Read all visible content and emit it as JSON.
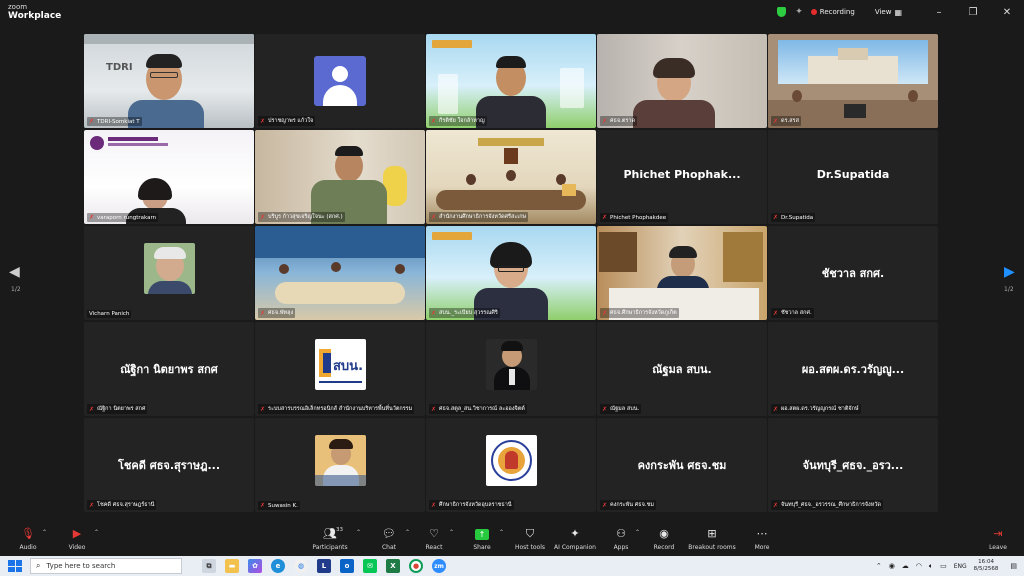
{
  "titlebar": {
    "logo_line1": "zoom",
    "logo_line2": "Workplace",
    "recording_label": "Recording",
    "view_label": "View",
    "minimize": "–",
    "restore": "❐",
    "close": "✕"
  },
  "tiles": [
    {
      "name": "TDRI-Somkiat T",
      "kind": "video",
      "active": true
    },
    {
      "name": "ปราชญาพร แก้วใจ",
      "kind": "placeholder"
    },
    {
      "name": "กีรติชัย ใจกล้าหาญ",
      "kind": "video"
    },
    {
      "name": "ศธจ.ตราด",
      "kind": "video"
    },
    {
      "name": "ดร.สรส",
      "kind": "video"
    },
    {
      "name": "varaporn rungtrakarn",
      "kind": "video"
    },
    {
      "name": "บริบูร ก้าวสุขเจริญใจนะ (สกศ.)",
      "kind": "video"
    },
    {
      "name": "สำนักงานศึกษาธิการจังหวัดศรีสะเกษ",
      "kind": "video"
    },
    {
      "name": "Phichet Phophakdee",
      "kind": "text",
      "display": "Phichet  Phophak..."
    },
    {
      "name": "Dr.Supatida",
      "kind": "text",
      "display": "Dr.Supatida"
    },
    {
      "name": "Vicharn Panich",
      "kind": "photo"
    },
    {
      "name": "ศธจ.พัทลุง",
      "kind": "video"
    },
    {
      "name": "สบน._ระเบียบ สุวรรณศิริ",
      "kind": "video"
    },
    {
      "name": "ศธจ.ศึกษาธิการจังหวัดภูเก็ต",
      "kind": "video"
    },
    {
      "name": "ชัชวาล สกศ.",
      "kind": "text",
      "display": "ชัชวาล สกศ."
    },
    {
      "name": "ณัฐิกา นิตยาพร สกศ",
      "kind": "text",
      "display": "ณัฐิกา นิตยาพร สกศ"
    },
    {
      "name": "ระบบสารบรรณอิเล็กทรอนิกส์ สำนักงานบริหารพื้นที่นวัตกรรม",
      "kind": "logo-sbn",
      "logo_text": "สบน."
    },
    {
      "name": "ศธจ.สตูล_สน.วิชาการณ์ ละอองจิตต์",
      "kind": "photo2"
    },
    {
      "name": "ณัฐมล สบน.",
      "kind": "text",
      "display": "ณัฐมล สบน."
    },
    {
      "name": "ผอ.สตผ.ดร.วรัญญูกรณ์ ชาติจักษ์",
      "kind": "text",
      "display": "ผอ.สตผ.ดร.วรัญญู..."
    },
    {
      "name": "โชคดี ศธจ.สุราษฎร์ธานี",
      "kind": "text",
      "display": "โชคดี ศธจ.สุราษฎ..."
    },
    {
      "name": "Suwasin K.",
      "kind": "photo3"
    },
    {
      "name": "ศึกษาธิการจังหวัดอุบลราชธานี",
      "kind": "logo-seal"
    },
    {
      "name": "คงกระพัน ศธจ.ชม",
      "kind": "text",
      "display": "คงกระพัน ศธจ.ชม"
    },
    {
      "name": "จันทบุรี_ศธจ._อรวรรณ_ศึกษาธิการจังหวัด",
      "kind": "text",
      "display": "จันทบุรี_ศธจ._อรว..."
    }
  ],
  "pager": {
    "left": "1/2",
    "right": "1/2"
  },
  "toolbar": {
    "audio": "Audio",
    "video": "Video",
    "participants": "Participants",
    "participants_count": "33",
    "chat": "Chat",
    "react": "React",
    "share": "Share",
    "host_tools": "Host tools",
    "ai_companion": "AI Companion",
    "apps": "Apps",
    "record": "Record",
    "breakout": "Breakout rooms",
    "more": "More",
    "leave": "Leave"
  },
  "taskbar": {
    "search_placeholder": "Type here to search",
    "lang": "ENG",
    "time": "16:04",
    "date": "8/5/2568",
    "app_l": "L",
    "app_x": "X",
    "app_zm": "zm"
  },
  "colors": {
    "active_border": "#27c93f",
    "recording": "#e52b2b",
    "share": "#27c93f",
    "muted": "#e53935"
  }
}
